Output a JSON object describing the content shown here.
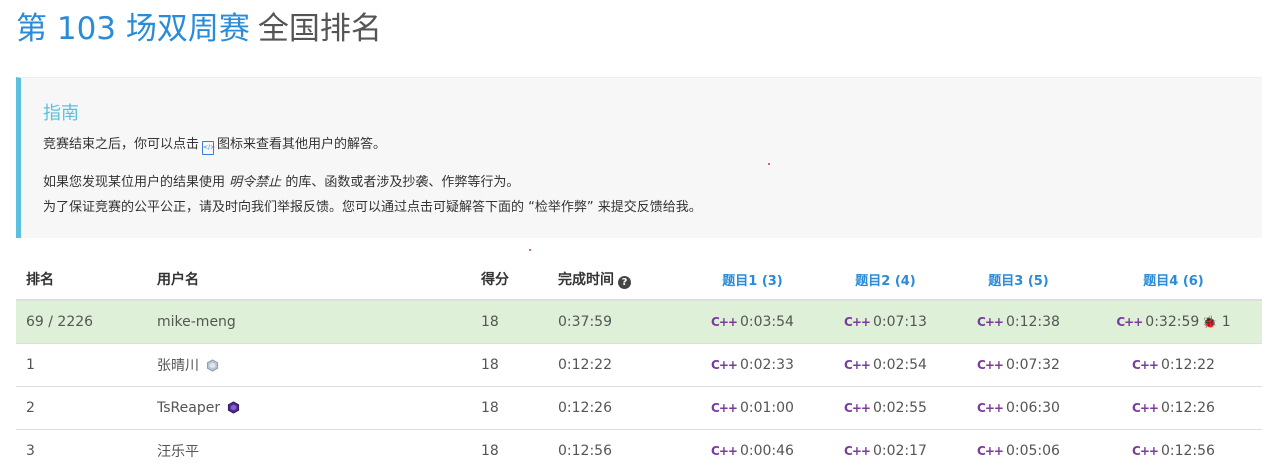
{
  "header": {
    "contest_title": "第 103 场双周赛",
    "rank_word": "全国排名"
  },
  "guide": {
    "title": "指南",
    "line1_before": "竞赛结束之后，你可以点击",
    "line1_after": "图标来查看其他用户的解答。",
    "line2_before": "如果您发现某位用户的结果使用",
    "line2_em": "明令禁止",
    "line2_after": "的库、函数或者涉及抄袭、作弊等行为。",
    "line3": "为了保证竞赛的公平公正，请及时向我们举报反馈。您可以通过点击可疑解答下面的 “检举作弊” 来提交反馈给我。"
  },
  "table": {
    "headers": {
      "rank": "排名",
      "username": "用户名",
      "score": "得分",
      "finish_time": "完成时间",
      "q1": "题目1 (3)",
      "q2": "题目2 (4)",
      "q3": "题目3 (5)",
      "q4": "题目4 (6)"
    },
    "rows": [
      {
        "rank": "69 / 2226",
        "username": "mike-meng",
        "score": "18",
        "finish": "0:37:59",
        "q1": "0:03:54",
        "q2": "0:07:13",
        "q3": "0:12:38",
        "q4": "0:32:59",
        "q4_wrong": "1"
      },
      {
        "rank": "1",
        "username": "张晴川",
        "score": "18",
        "finish": "0:12:22",
        "q1": "0:02:33",
        "q2": "0:02:54",
        "q3": "0:07:32",
        "q4": "0:12:22"
      },
      {
        "rank": "2",
        "username": "TsReaper",
        "score": "18",
        "finish": "0:12:26",
        "q1": "0:01:00",
        "q2": "0:02:55",
        "q3": "0:06:30",
        "q4": "0:12:26"
      },
      {
        "rank": "3",
        "username": "汪乐平",
        "score": "18",
        "finish": "0:12:56",
        "q1": "0:00:46",
        "q2": "0:02:17",
        "q3": "0:05:06",
        "q4": "0:12:56"
      }
    ]
  },
  "icons": {
    "lang": "cpp-icon",
    "help": "question-circle-icon",
    "bug": "bug-icon",
    "solution": "code-file-icon"
  },
  "colors": {
    "accent": "#2a8bd8",
    "guide_border": "#5bc0de",
    "highlight_row": "#dff0d8",
    "cpp": "#7a3b9c",
    "orange_name": "#f0ad4e"
  }
}
